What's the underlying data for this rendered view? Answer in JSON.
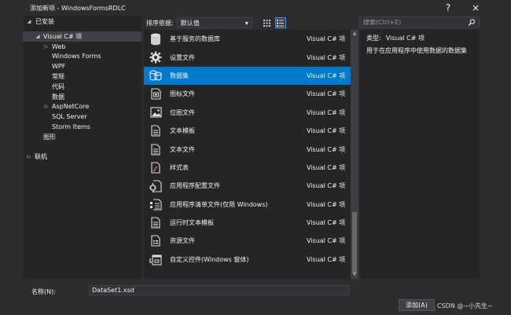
{
  "window": {
    "title": "添加新项 - WindowsFormsRDLC",
    "help_label": "?",
    "close_label": "×"
  },
  "left": {
    "header": "已安装",
    "tree": [
      {
        "label": "Visual C# 项",
        "level": 1,
        "arrow": "down",
        "selected": true
      },
      {
        "label": "Web",
        "level": 2,
        "arrow": "right"
      },
      {
        "label": "Windows Forms",
        "level": 2,
        "arrow": ""
      },
      {
        "label": "WPF",
        "level": 2,
        "arrow": ""
      },
      {
        "label": "常规",
        "level": 2,
        "arrow": ""
      },
      {
        "label": "代码",
        "level": 2,
        "arrow": ""
      },
      {
        "label": "数据",
        "level": 2,
        "arrow": ""
      },
      {
        "label": "AspNetCore",
        "level": 2,
        "arrow": "right"
      },
      {
        "label": "SQL Server",
        "level": 2,
        "arrow": ""
      },
      {
        "label": "Storm Items",
        "level": 2,
        "arrow": ""
      },
      {
        "label": "图形",
        "level": 1,
        "arrow": ""
      },
      {
        "label": "",
        "level": 0,
        "arrow": ""
      },
      {
        "label": "联机",
        "level": 0,
        "arrow": "right"
      }
    ]
  },
  "toolbar": {
    "sort_label": "排序依据:",
    "sort_value": "默认值"
  },
  "search": {
    "placeholder": "搜索(Ctrl+E)"
  },
  "list": {
    "items": [
      {
        "name": "基于服务的数据库",
        "type": "Visual C# 项",
        "icon": "database-icon"
      },
      {
        "name": "设置文件",
        "type": "Visual C# 项",
        "icon": "gear-icon"
      },
      {
        "name": "数据集",
        "type": "Visual C# 项",
        "icon": "dataset-icon",
        "selected": true
      },
      {
        "name": "图标文件",
        "type": "Visual C# 项",
        "icon": "icon-file-icon"
      },
      {
        "name": "位图文件",
        "type": "Visual C# 项",
        "icon": "image-icon"
      },
      {
        "name": "文本模板",
        "type": "Visual C# 项",
        "icon": "document-icon"
      },
      {
        "name": "文本文件",
        "type": "Visual C# 项",
        "icon": "document-icon"
      },
      {
        "name": "样式表",
        "type": "Visual C# 项",
        "icon": "stylesheet-icon"
      },
      {
        "name": "应用程序配置文件",
        "type": "Visual C# 项",
        "icon": "config-icon"
      },
      {
        "name": "应用程序清单文件(仅限 Windows)",
        "type": "Visual C# 项",
        "icon": "manifest-icon"
      },
      {
        "name": "运行时文本模板",
        "type": "Visual C# 项",
        "icon": "document-icon"
      },
      {
        "name": "资源文件",
        "type": "Visual C# 项",
        "icon": "resource-icon"
      },
      {
        "name": "自定义控件(Windows 窗体)",
        "type": "Visual C# 项",
        "icon": "custom-control-icon"
      }
    ]
  },
  "info": {
    "type_label": "类型:",
    "type_value": "Visual C# 项",
    "description": "用于在应用程序中使用数据的数据集"
  },
  "bottom": {
    "name_label": "名称(N):",
    "name_value": "DataSet1.xsd",
    "add_label": "添加(A)",
    "watermark": "CSDN @~小先生~"
  }
}
